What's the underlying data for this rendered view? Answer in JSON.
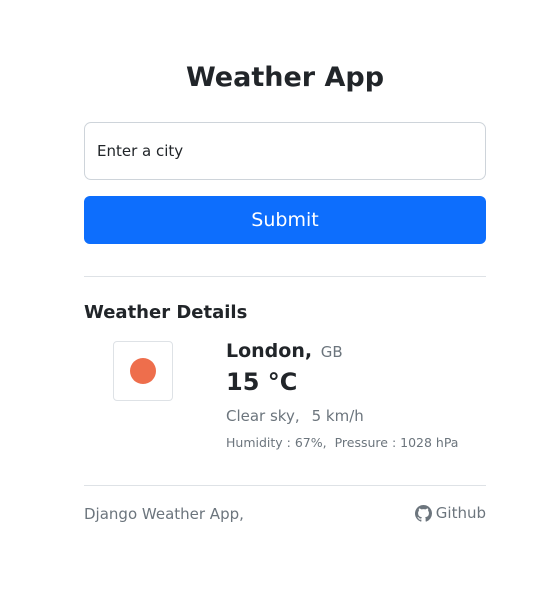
{
  "header": {
    "title": "Weather App"
  },
  "search": {
    "placeholder": "Enter a city",
    "value": ""
  },
  "actions": {
    "submit_label": "Submit"
  },
  "weather": {
    "section_title": "Weather Details",
    "city": "London,",
    "country": "GB",
    "temperature": "15 °C",
    "description": "Clear sky,",
    "wind": "5 km/h",
    "humidity": "Humidity : 67%,",
    "pressure": "Pressure : 1028 hPa",
    "icon": "sun-icon",
    "icon_color": "#ee6e4c"
  },
  "footer": {
    "app_name": "Django Weather App,",
    "link_label": "Github",
    "link_icon": "github-icon"
  },
  "colors": {
    "primary": "#0d6efd",
    "muted": "#6c757d",
    "text": "#212529"
  }
}
